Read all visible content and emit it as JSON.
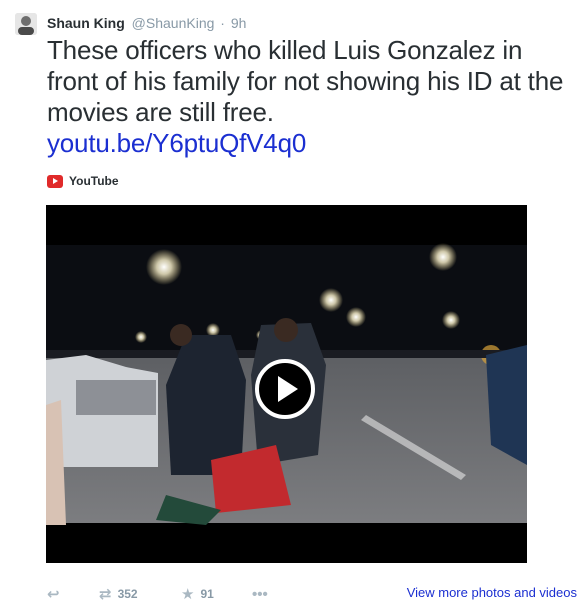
{
  "tweet": {
    "author_name": "Shaun King",
    "author_handle": "@ShaunKing",
    "separator": "·",
    "time": "9h",
    "text": "These officers who killed Luis Gonzalez in front of his family for not showing his ID at the movies are still free.",
    "link": "youtu.be/Y6ptuQfV4q0",
    "source_label": "YouTube"
  },
  "actions": {
    "retweet_count": "352",
    "favorite_count": "91",
    "more_link": "View more photos and videos"
  },
  "icons": {
    "reply": "reply-icon",
    "retweet": "retweet-icon",
    "favorite": "star-icon",
    "more": "more-dots-icon",
    "play": "play-icon",
    "source": "youtube-icon"
  },
  "colors": {
    "link": "#1b2fd1",
    "text": "#292f33",
    "meta": "#8899a6",
    "youtube_red": "#e02a2a",
    "video_background": "#000000"
  }
}
